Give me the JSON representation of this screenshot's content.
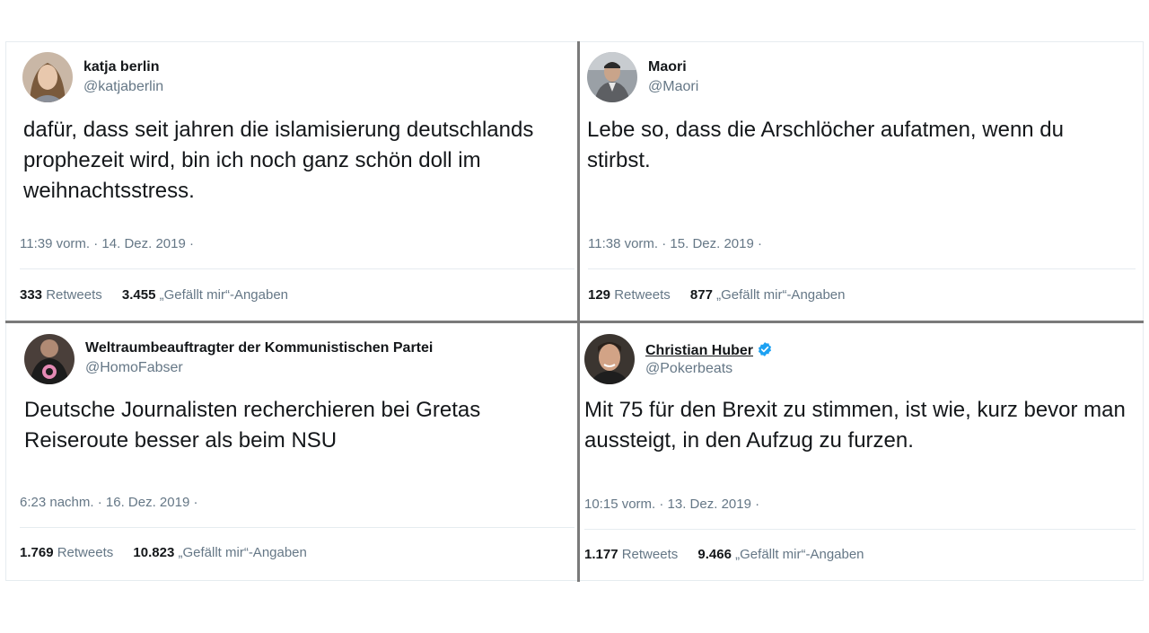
{
  "tweets": [
    {
      "display_name": "katja berlin",
      "handle": "@katjaberlin",
      "text": "dafür, dass seit jahren die islamisierung deutschlands prophezeit wird, bin ich noch ganz schön doll im weihnachtsstress.",
      "timestamp": "11:39 vorm. · 14. Dez. 2019 ·",
      "retweets": "333",
      "retweets_label": "Retweets",
      "likes": "3.455",
      "likes_label": "„Gefällt mir“-Angaben",
      "verified": false
    },
    {
      "display_name": "Maori",
      "handle": "@Maori",
      "text": "Lebe so, dass die Arschlöcher aufatmen, wenn du stirbst.",
      "timestamp": "11:38 vorm. · 15. Dez. 2019 ·",
      "retweets": "129",
      "retweets_label": "Retweets",
      "likes": "877",
      "likes_label": "„Gefällt mir“-Angaben",
      "verified": false
    },
    {
      "display_name": "Weltraumbeauftragter der Kommunistischen Partei",
      "handle": "@HomoFabser",
      "text": "Deutsche Journalisten recherchieren bei Gretas Reiseroute besser als beim NSU",
      "timestamp": "6:23 nachm. · 16. Dez. 2019 ·",
      "retweets": "1.769",
      "retweets_label": "Retweets",
      "likes": "10.823",
      "likes_label": "„Gefällt mir“-Angaben",
      "verified": false
    },
    {
      "display_name": "Christian Huber",
      "handle": "@Pokerbeats",
      "text": "Mit 75 für den Brexit zu stimmen, ist wie, kurz bevor man aussteigt, in den Aufzug zu furzen.",
      "timestamp": "10:15 vorm. · 13. Dez. 2019 ·",
      "retweets": "1.177",
      "retweets_label": "Retweets",
      "likes": "9.466",
      "likes_label": "„Gefällt mir“-Angaben",
      "verified": true
    }
  ],
  "colors": {
    "text": "#14171a",
    "muted": "#657786",
    "separator": "#e6ecf0",
    "divider": "#7a7a7a",
    "verified": "#1da1f2"
  }
}
